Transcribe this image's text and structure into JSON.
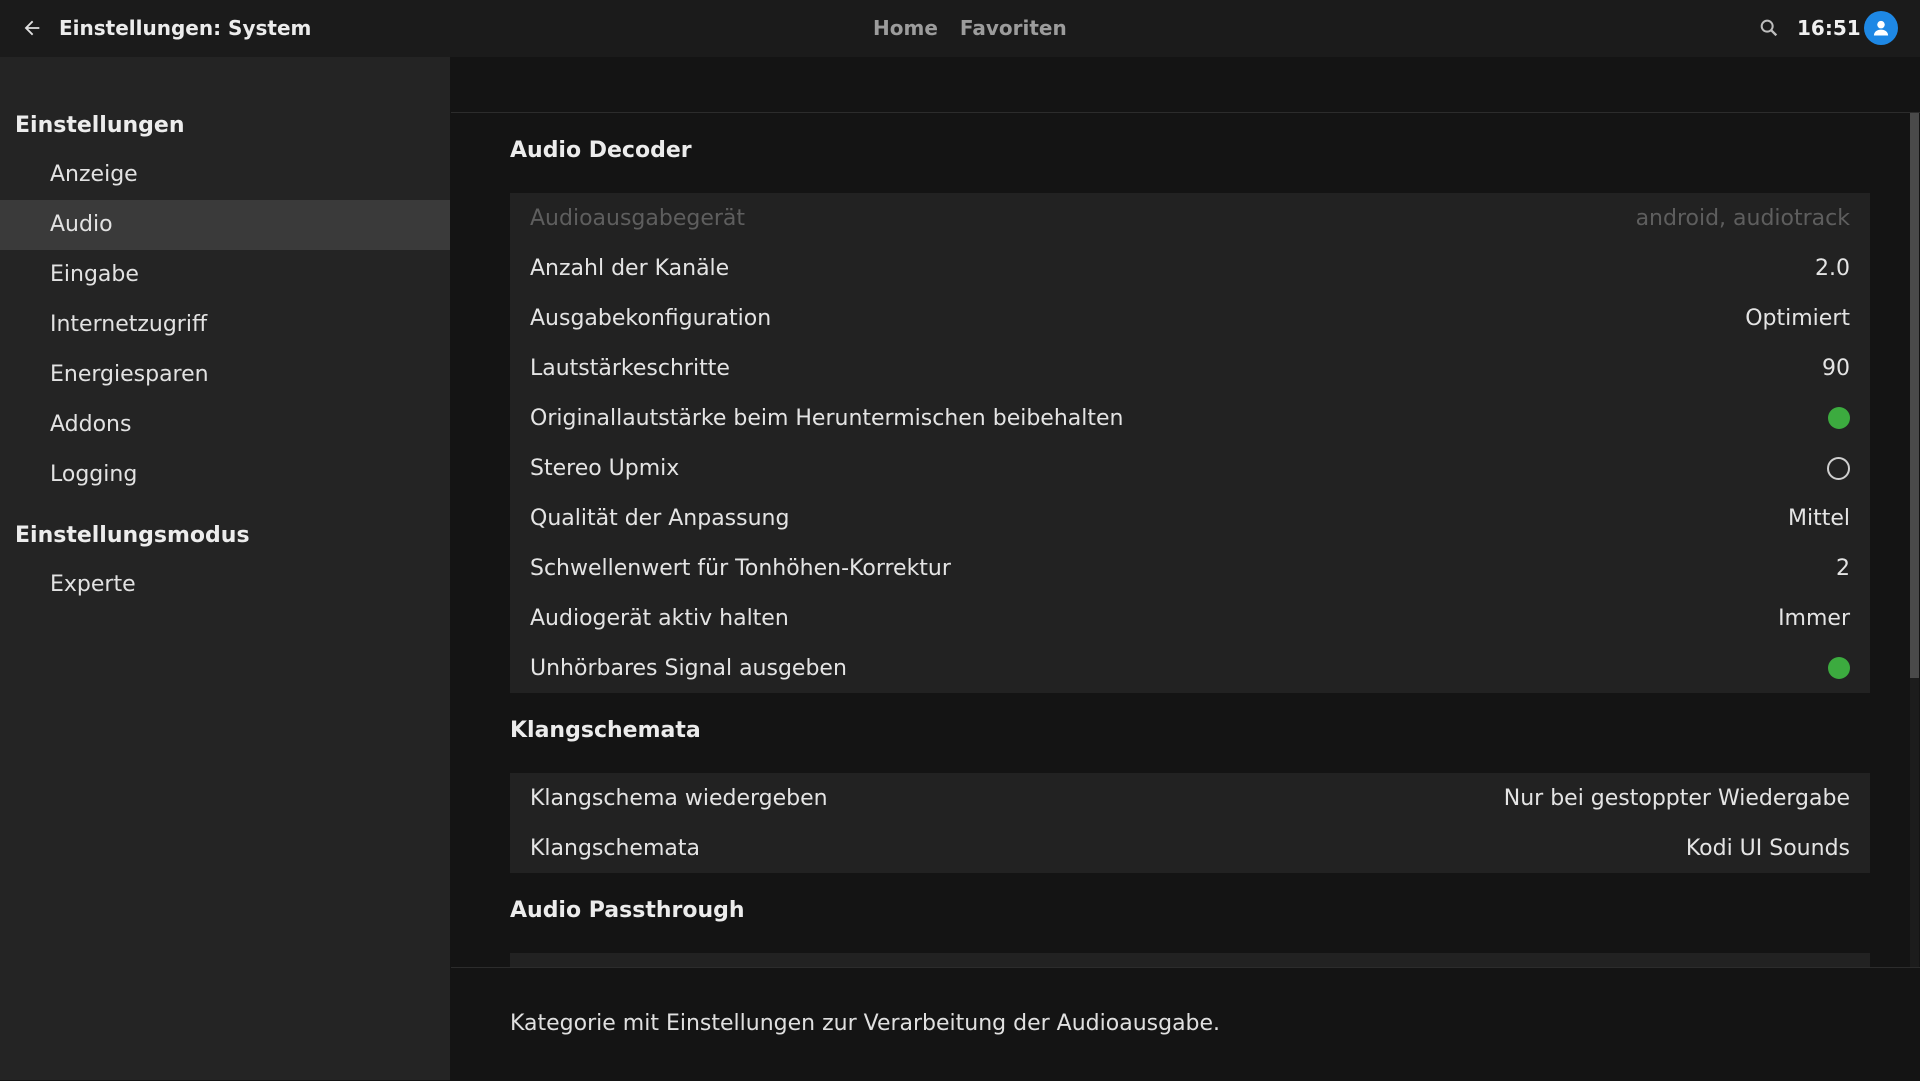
{
  "header": {
    "back_icon": "arrow-left-icon",
    "title": "Einstellungen: System",
    "nav": [
      "Home",
      "Favoriten"
    ],
    "search_icon": "search-icon",
    "clock": "16:51",
    "avatar_icon": "user-icon",
    "avatar_color": "#1e88e5"
  },
  "sidebar": {
    "group1_title": "Einstellungen",
    "items": [
      "Anzeige",
      "Audio",
      "Eingabe",
      "Internetzugriff",
      "Energiesparen",
      "Addons",
      "Logging"
    ],
    "active_item": "Audio",
    "group2_title": "Einstellungsmodus",
    "mode_item": "Experte"
  },
  "sections": {
    "audio_decoder": {
      "title": "Audio Decoder",
      "rows": [
        {
          "label": "Audioausgabegerät",
          "value": "android, audiotrack",
          "disabled": true
        },
        {
          "label": "Anzahl der Kanäle",
          "value": "2.0"
        },
        {
          "label": "Ausgabekonfiguration",
          "value": "Optimiert"
        },
        {
          "label": "Lautstärkeschritte",
          "value": "90"
        },
        {
          "label": "Originallautstärke beim Heruntermischen beibehalten",
          "toggle": true
        },
        {
          "label": "Stereo Upmix",
          "toggle": false
        },
        {
          "label": "Qualität der Anpassung",
          "value": "Mittel"
        },
        {
          "label": "Schwellenwert für Tonhöhen-Korrektur",
          "value": "2"
        },
        {
          "label": "Audiogerät aktiv halten",
          "value": "Immer"
        },
        {
          "label": "Unhörbares Signal ausgeben",
          "toggle": true
        }
      ]
    },
    "klangschemata": {
      "title": "Klangschemata",
      "rows": [
        {
          "label": "Klangschema wiedergeben",
          "value": "Nur bei gestoppter Wiedergabe"
        },
        {
          "label": "Klangschemata",
          "value": "Kodi UI Sounds"
        }
      ]
    },
    "passthrough": {
      "title": "Audio Passthrough"
    }
  },
  "footer": {
    "description": "Kategorie mit Einstellungen zur Verarbeitung der Audioausgabe."
  },
  "colors": {
    "toggle_on": "#3cab3f",
    "background": "#141414",
    "sidebar": "#242424",
    "panel": "#222222"
  }
}
